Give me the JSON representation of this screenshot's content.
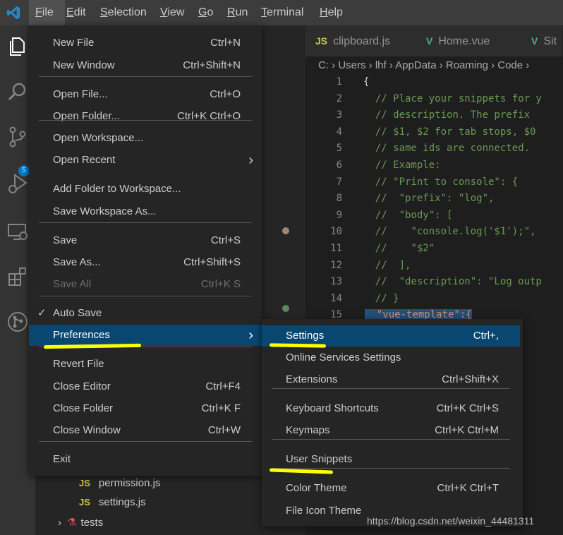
{
  "menubar": {
    "items": [
      "File",
      "Edit",
      "Selection",
      "View",
      "Go",
      "Run",
      "Terminal",
      "Help"
    ],
    "underline": [
      "F",
      "E",
      "S",
      "V",
      "G",
      "R",
      "T",
      "H"
    ],
    "rest": [
      "ile",
      "dit",
      "election",
      "iew",
      "o",
      "un",
      "erminal",
      "elp"
    ]
  },
  "activity_bar": {
    "badge": "5"
  },
  "tabs": [
    {
      "icon": "JS",
      "label": "clipboard.js"
    },
    {
      "icon": "V",
      "label": "Home.vue"
    },
    {
      "icon": "V",
      "label": "Sit"
    }
  ],
  "breadcrumb": "C: › Users › lhf › AppData › Roaming › Code ›",
  "code_lines": [
    {
      "n": "1",
      "t": "{"
    },
    {
      "n": "2",
      "t": "  // Place your snippets for y"
    },
    {
      "n": "3",
      "t": "  // description. The prefix "
    },
    {
      "n": "4",
      "t": "  // $1, $2 for tab stops, $0"
    },
    {
      "n": "5",
      "t": "  // same ids are connected."
    },
    {
      "n": "6",
      "t": "  // Example:"
    },
    {
      "n": "7",
      "t": "  // \"Print to console\": {"
    },
    {
      "n": "8",
      "t": "  //  \"prefix\": \"log\","
    },
    {
      "n": "9",
      "t": "  //  \"body\": ["
    },
    {
      "n": "10",
      "t": "  //    \"console.log('$1');\","
    },
    {
      "n": "11",
      "t": "  //    \"$2\""
    },
    {
      "n": "12",
      "t": "  //  ],"
    },
    {
      "n": "13",
      "t": "  //  \"description\": \"Log outp"
    },
    {
      "n": "14",
      "t": "  // }"
    },
    {
      "n": "15",
      "t": "  \"vue-template\":{"
    }
  ],
  "file_menu": {
    "items": [
      {
        "label": "New File",
        "kb": "Ctrl+N"
      },
      {
        "label": "New Window",
        "kb": "Ctrl+Shift+N"
      },
      {
        "label": "Open File...",
        "kb": "Ctrl+O"
      },
      {
        "label": "Open Folder...",
        "kb": "Ctrl+K Ctrl+O"
      },
      {
        "label": "Open Workspace...",
        "kb": ""
      },
      {
        "label": "Open Recent",
        "kb": ""
      },
      {
        "label": "Add Folder to Workspace...",
        "kb": ""
      },
      {
        "label": "Save Workspace As...",
        "kb": ""
      },
      {
        "label": "Save",
        "kb": "Ctrl+S"
      },
      {
        "label": "Save As...",
        "kb": "Ctrl+Shift+S"
      },
      {
        "label": "Save All",
        "kb": "Ctrl+K S"
      },
      {
        "label": "Auto Save",
        "kb": ""
      },
      {
        "label": "Preferences",
        "kb": ""
      },
      {
        "label": "Revert File",
        "kb": ""
      },
      {
        "label": "Close Editor",
        "kb": "Ctrl+F4"
      },
      {
        "label": "Close Folder",
        "kb": "Ctrl+K F"
      },
      {
        "label": "Close Window",
        "kb": "Ctrl+W"
      },
      {
        "label": "Exit",
        "kb": ""
      }
    ]
  },
  "preferences_menu": {
    "items": [
      {
        "label": "Settings",
        "kb": "Ctrl+,"
      },
      {
        "label": "Online Services Settings",
        "kb": ""
      },
      {
        "label": "Extensions",
        "kb": "Ctrl+Shift+X"
      },
      {
        "label": "Keyboard Shortcuts",
        "kb": "Ctrl+K Ctrl+S"
      },
      {
        "label": "Keymaps",
        "kb": "Ctrl+K Ctrl+M"
      },
      {
        "label": "User Snippets",
        "kb": ""
      },
      {
        "label": "Color Theme",
        "kb": "Ctrl+K Ctrl+T"
      },
      {
        "label": "File Icon Theme",
        "kb": ""
      }
    ]
  },
  "explorer": {
    "files": [
      {
        "icon": "JS",
        "label": "permission.js"
      },
      {
        "icon": "JS",
        "label": "settings.js"
      }
    ],
    "folder": "tests"
  },
  "watermark": "https://blog.csdn.net/weixin_44481311",
  "colors": {
    "accent": "#007acc",
    "selection": "#094771",
    "highlighter": "#ffff00"
  }
}
